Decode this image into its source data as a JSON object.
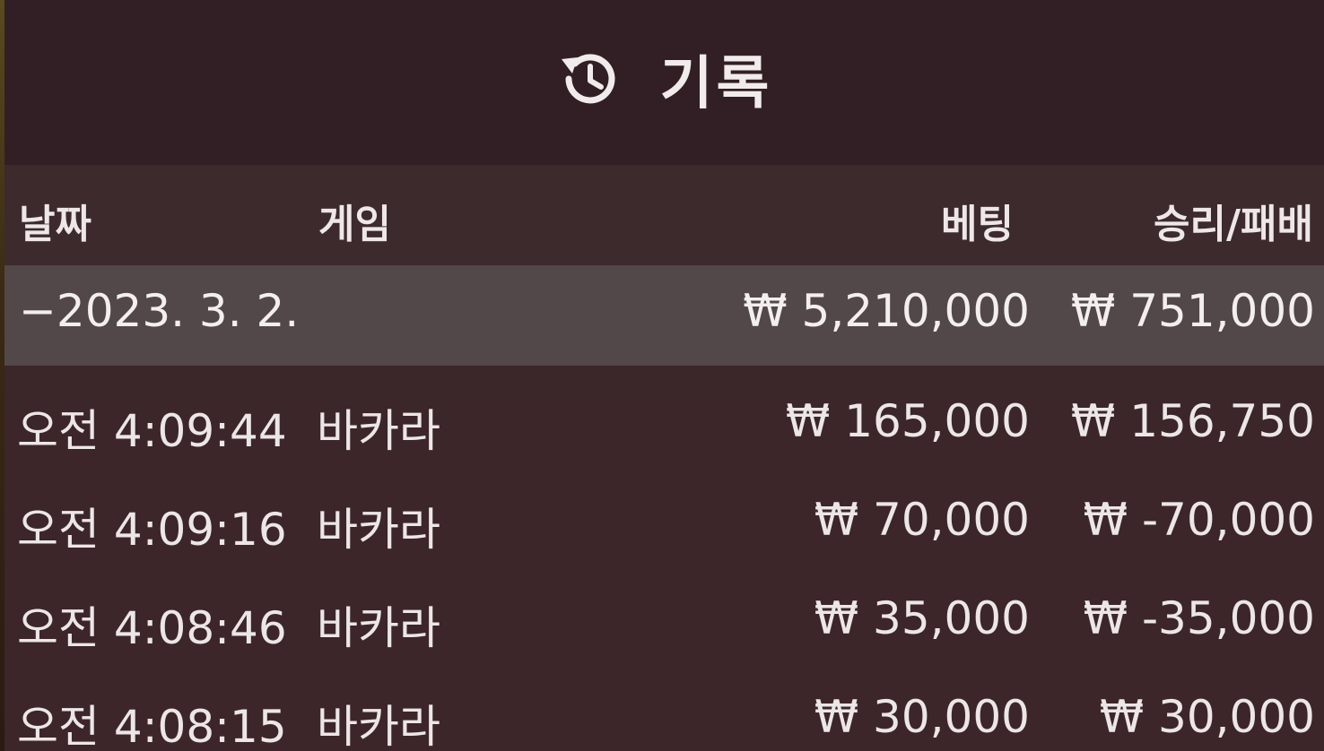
{
  "title": {
    "icon": "history-icon",
    "text": "기록"
  },
  "columns": {
    "date": "날짜",
    "game": "게임",
    "bet": "베팅",
    "win_loss": "승리/패배"
  },
  "group": {
    "date": "−2023. 3. 2.",
    "bet": "₩ 5,210,000",
    "win_loss": "₩ 751,000"
  },
  "rows": [
    {
      "time": "오전 4:09:44",
      "game": "바카라",
      "bet": "₩ 165,000",
      "win_loss": "₩ 156,750"
    },
    {
      "time": "오전 4:09:16",
      "game": "바카라",
      "bet": "₩ 70,000",
      "win_loss": "₩ -70,000"
    },
    {
      "time": "오전 4:08:46",
      "game": "바카라",
      "bet": "₩ 35,000",
      "win_loss": "₩ -35,000"
    },
    {
      "time": "오전 4:08:15",
      "game": "바카라",
      "bet": "₩ 30,000",
      "win_loss": "₩ 30,000"
    }
  ],
  "colors": {
    "background": "#3d2629",
    "title_bar": "#321f25",
    "header_row": "#3c2a2d",
    "group_row": "#524749",
    "text": "#ece7e7"
  }
}
